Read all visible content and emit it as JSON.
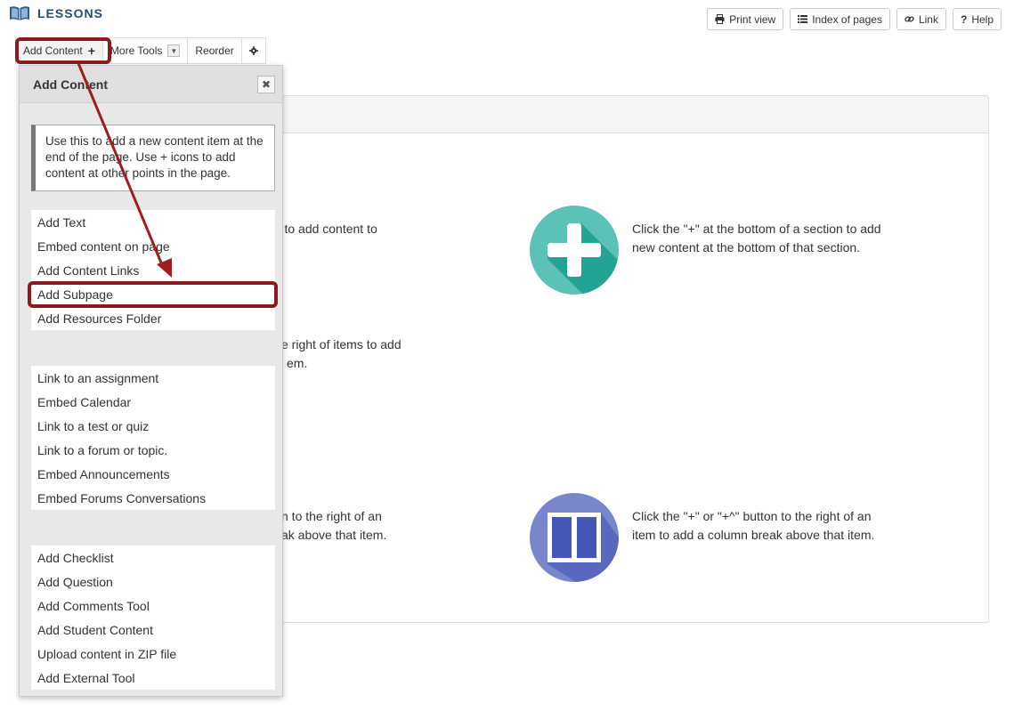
{
  "header": {
    "title": "LESSONS"
  },
  "top_buttons": {
    "print": "Print view",
    "index": "Index of pages",
    "link": "Link",
    "help": "Help"
  },
  "toolbar": {
    "add_content": "Add Content",
    "add_plus": "+",
    "more_tools": "More Tools",
    "reorder": "Reorder"
  },
  "panel": {
    "text1a": "ab to add content to",
    "text2a": "Click the \"+\" at the bottom of a section to add",
    "text2b": "new content at the bottom of that section.",
    "text3a": "e right of items to add",
    "text3b": "em.",
    "text4a": "n to the right of an",
    "text4b": "ak above that item.",
    "text5a": "Click the \"+\" or \"+^\" button to the right of an",
    "text5b": "item to add a column break above that item."
  },
  "dropdown": {
    "title": "Add Content",
    "info": "Use this to add a new content item at the end of the page. Use + icons to add content at other points in the page.",
    "group1": [
      "Add Text",
      "Embed content on page",
      "Add Content Links",
      "Add Subpage",
      "Add Resources Folder"
    ],
    "group2": [
      "Link to an assignment",
      "Embed Calendar",
      "Link to a test or quiz",
      "Link to a forum or topic.",
      "Embed Announcements",
      "Embed Forums Conversations"
    ],
    "group3": [
      "Add Checklist",
      "Add Question",
      "Add Comments Tool",
      "Add Student Content",
      "Upload content in ZIP file",
      "Add External Tool"
    ]
  },
  "colors": {
    "annotation": "#8b1a1a",
    "plus_circle": "#5cc2b8",
    "columns_circle": "#7986cb"
  }
}
